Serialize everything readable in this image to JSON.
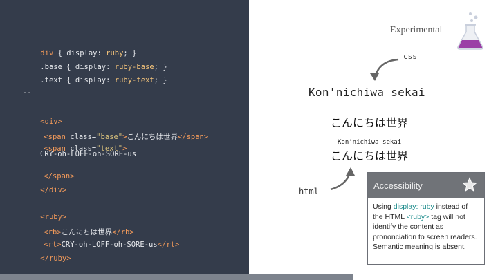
{
  "code": {
    "line1": {
      "sel": "div",
      "open": " { ",
      "prop": "display:",
      "val": " ruby",
      "close": "; }"
    },
    "line2": {
      "sel": ".base",
      "open": " { ",
      "prop": "display:",
      "val": " ruby-base",
      "close": "; }"
    },
    "line3": {
      "sel": ".text",
      "open": " { ",
      "prop": "display:",
      "val": " ruby-text",
      "close": "; }"
    },
    "separator": "--",
    "div_open": "<div>",
    "span1_open_a": "<span ",
    "span1_attr": "class=",
    "span1_val": "\"base\"",
    "span1_gt": ">",
    "span1_text": "こんにちは世界",
    "span1_close": "</span>",
    "span2_open_a": "<span ",
    "span2_attr": "class=",
    "span2_val": "\"text\"",
    "span2_gt": ">",
    "span2_text": "CRY-oh-LOFF-oh-SORE-us",
    "span2_close": "</span>",
    "div_close": "</div>",
    "ruby_open": "<ruby>",
    "rb_open": "<rb>",
    "rb_text": "こんにちは世界",
    "rb_close": "</rb>",
    "rt_open": "<rt>",
    "rt_text": "CRY-oh-LOFF-oh-SORE-us",
    "rt_close": "</rt>",
    "ruby_close": "</ruby>"
  },
  "header": {
    "experimental": "Experimental"
  },
  "labels": {
    "css": "css",
    "html": "html"
  },
  "demo": {
    "romaji_large": "Kon'nichiwa sekai",
    "japanese_1": "こんにちは世界",
    "ruby_small": "Kon'nichiwa sekai",
    "japanese_2": "こんにちは世界"
  },
  "card": {
    "title": "Accessibility",
    "body_pre": "Using ",
    "body_hl1": "display: ruby",
    "body_mid": " instead of the HTML ",
    "body_hl2": "<ruby>",
    "body_post": " tag will not identify the content as prononciation to screen readers. Semantic meaning is absent."
  },
  "colors": {
    "code_bg": "#343c4b",
    "tag": "#f29a5a",
    "value": "#f2c27a",
    "accent_teal": "#1a8a8a",
    "flask_liquid": "#9b3fa6"
  },
  "icons": [
    "flask-icon",
    "star-icon",
    "curved-arrow-icon"
  ]
}
